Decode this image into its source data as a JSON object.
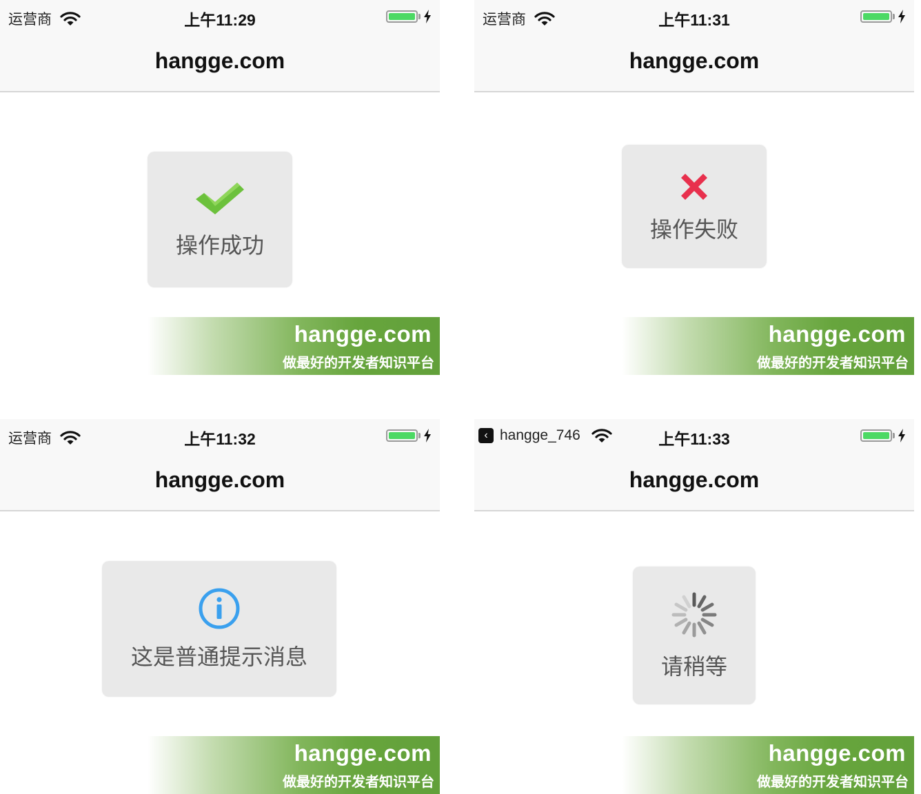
{
  "nav_title": "hangge.com",
  "banner": {
    "domain": "hangge.com",
    "slogan": "做最好的开发者知识平台"
  },
  "colors": {
    "success": "#6cc13c",
    "error": "#e8304d",
    "info": "#3aa0ee",
    "battery": "#4cd964",
    "banner_green": "#62a03a"
  },
  "screens": [
    {
      "carrier": "运营商",
      "time": "上午11:29",
      "hud": {
        "icon": "checkmark-icon",
        "text": "操作成功"
      }
    },
    {
      "carrier": "运营商",
      "time": "上午11:31",
      "hud": {
        "icon": "cross-icon",
        "text": "操作失败"
      }
    },
    {
      "carrier": "运营商",
      "time": "上午11:32",
      "hud": {
        "icon": "info-icon",
        "text": "这是普通提示消息"
      }
    },
    {
      "back_app": "hangge_746",
      "time": "上午11:33",
      "hud": {
        "icon": "spinner-icon",
        "text": "请稍等"
      }
    }
  ]
}
